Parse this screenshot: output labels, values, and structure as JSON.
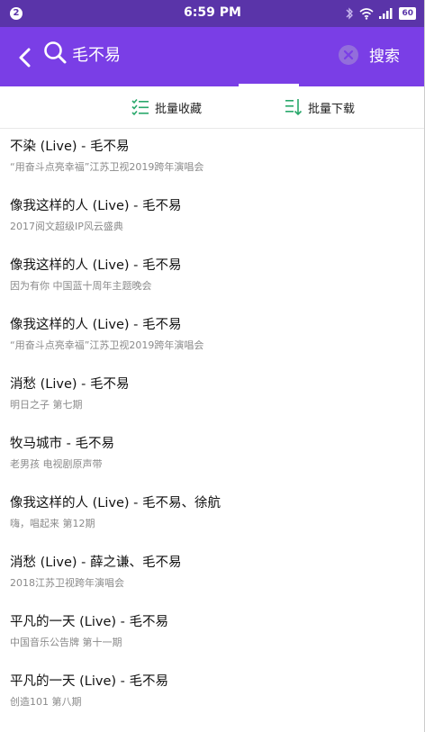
{
  "status_bar": {
    "notification_count": "2",
    "time": "6:59 PM",
    "battery": "60"
  },
  "app_bar": {
    "query": "毛不易",
    "search_label": "搜索"
  },
  "toolbar": {
    "batch_collect": "批量收藏",
    "batch_download": "批量下载"
  },
  "results": [
    {
      "title": "不染 (Live) - 毛不易",
      "sub": "“用奋斗点亮幸福”江苏卫视2019跨年演唱会"
    },
    {
      "title": "像我这样的人 (Live) - 毛不易",
      "sub": "2017阅文超级IP风云盛典"
    },
    {
      "title": "像我这样的人 (Live) - 毛不易",
      "sub": "因为有你 中国蓝十周年主题晚会"
    },
    {
      "title": "像我这样的人 (Live) - 毛不易",
      "sub": "“用奋斗点亮幸福”江苏卫视2019跨年演唱会"
    },
    {
      "title": "消愁 (Live) - 毛不易",
      "sub": "明日之子 第七期"
    },
    {
      "title": "牧马城市 - 毛不易",
      "sub": "老男孩 电视剧原声带"
    },
    {
      "title": "像我这样的人 (Live) - 毛不易、徐航",
      "sub": "嗨，唱起来 第12期"
    },
    {
      "title": "消愁 (Live) - 薛之谦、毛不易",
      "sub": "2018江苏卫视跨年演唱会"
    },
    {
      "title": "平凡的一天 (Live) - 毛不易",
      "sub": "中国音乐公告牌 第十一期"
    },
    {
      "title": "平凡的一天 (Live) - 毛不易",
      "sub": "创造101 第八期"
    }
  ],
  "colors": {
    "status_bar": "#5a34a9",
    "app_bar": "#7a3ee6",
    "accent_green": "#29a86b"
  }
}
